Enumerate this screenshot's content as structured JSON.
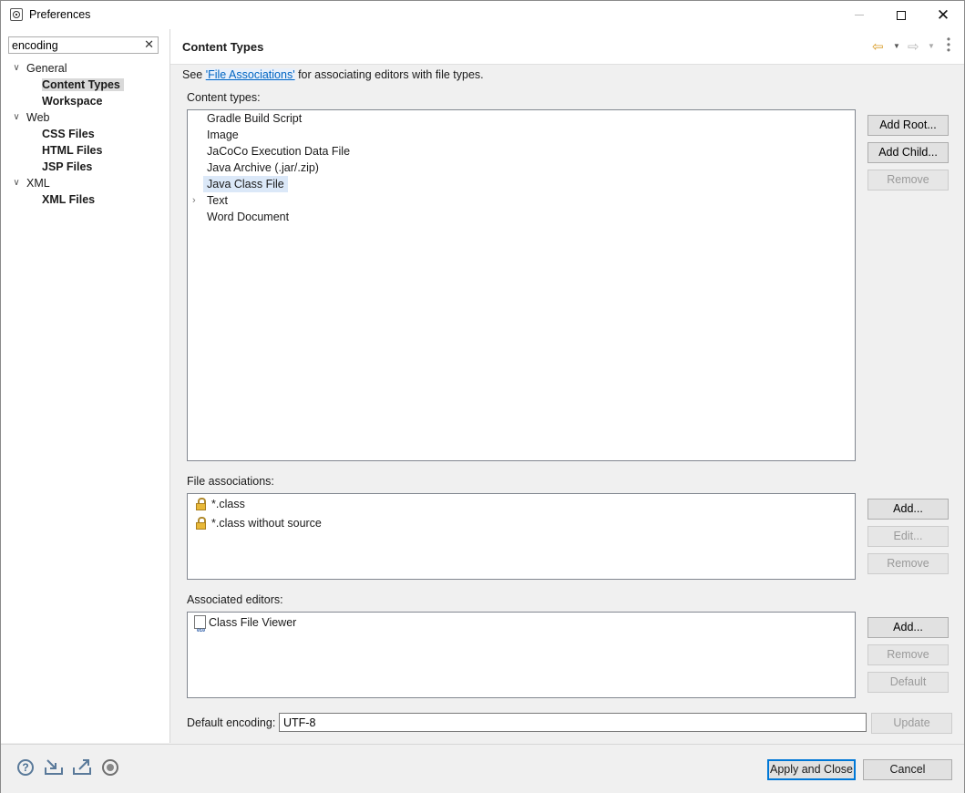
{
  "window": {
    "title": "Preferences"
  },
  "sidebar": {
    "filter": {
      "value": "encoding"
    },
    "tree": [
      {
        "label": "General",
        "children": [
          "Content Types",
          "Workspace"
        ]
      },
      {
        "label": "Web",
        "children": [
          "CSS Files",
          "HTML Files",
          "JSP Files"
        ]
      },
      {
        "label": "XML",
        "children": [
          "XML Files"
        ]
      }
    ],
    "selected": "Content Types"
  },
  "page": {
    "title": "Content Types",
    "description_prefix": "See ",
    "description_link": "'File Associations'",
    "description_suffix": " for associating editors with file types.",
    "content_types_label": "Content types:",
    "content_types": [
      "Gradle Build Script",
      "Image",
      "JaCoCo Execution Data File",
      "Java Archive (.jar/.zip)",
      "Java Class File",
      "Text",
      "Word Document"
    ],
    "selected_content_type": "Java Class File",
    "content_type_buttons": {
      "add_root": "Add Root...",
      "add_child": "Add Child...",
      "remove": "Remove"
    },
    "file_associations_label": "File associations:",
    "file_associations": [
      "*.class",
      "*.class without source"
    ],
    "file_assoc_buttons": {
      "add": "Add...",
      "edit": "Edit...",
      "remove": "Remove"
    },
    "associated_editors_label": "Associated editors:",
    "associated_editors": [
      "Class File Viewer"
    ],
    "editor_buttons": {
      "add": "Add...",
      "remove": "Remove",
      "default": "Default"
    },
    "default_encoding_label": "Default encoding:",
    "default_encoding_value": "UTF-8",
    "update_button": "Update"
  },
  "footer": {
    "apply_close": "Apply and Close",
    "cancel": "Cancel"
  },
  "icons": {
    "back": "back-arrow-icon",
    "forward": "forward-arrow-icon",
    "view_menu": "view-menu-icon",
    "help": "help-icon",
    "import": "import-icon",
    "export": "export-icon",
    "record": "record-icon",
    "lock": "lock-icon"
  },
  "colors": {
    "accent": "#0078d7",
    "link": "#0065c2",
    "selection": "#dbe8f8"
  }
}
